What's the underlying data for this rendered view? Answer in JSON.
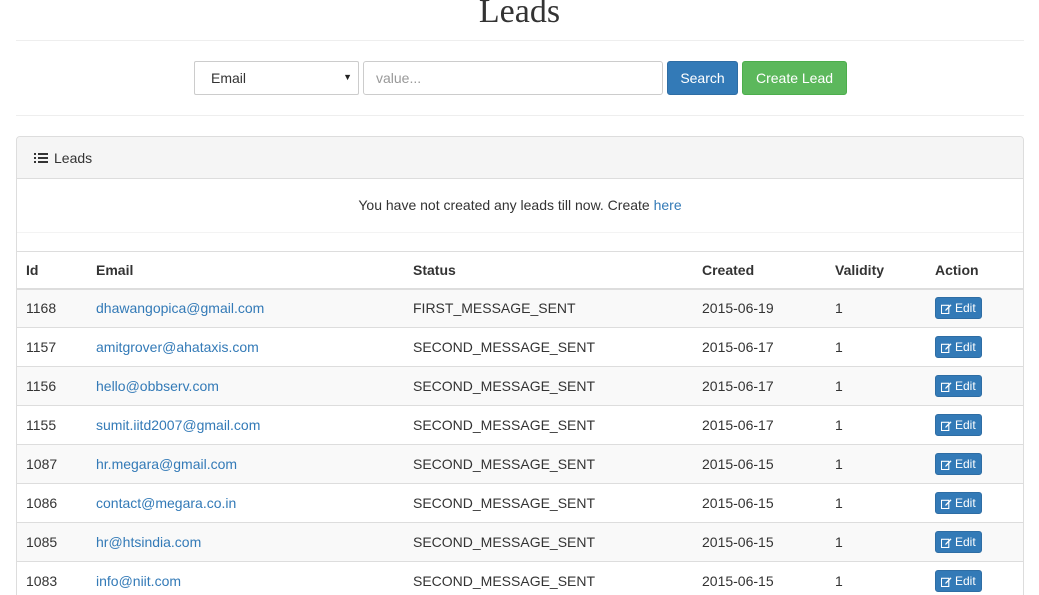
{
  "page": {
    "title": "Leads"
  },
  "search": {
    "field_selected": "Email",
    "placeholder": "value...",
    "search_label": "Search",
    "create_label": "Create Lead"
  },
  "panel": {
    "heading": "Leads",
    "heading_icon": "list-icon",
    "empty_message": "You have not created any leads till now. Create",
    "empty_link": "here"
  },
  "table": {
    "columns": [
      "Id",
      "Email",
      "Status",
      "Created",
      "Validity",
      "Action"
    ],
    "edit_label": "Edit",
    "rows": [
      {
        "id": "1168",
        "email": "dhawangopica@gmail.com",
        "status": "FIRST_MESSAGE_SENT",
        "created": "2015-06-19",
        "validity": "1"
      },
      {
        "id": "1157",
        "email": "amitgrover@ahataxis.com",
        "status": "SECOND_MESSAGE_SENT",
        "created": "2015-06-17",
        "validity": "1"
      },
      {
        "id": "1156",
        "email": "hello@obbserv.com",
        "status": "SECOND_MESSAGE_SENT",
        "created": "2015-06-17",
        "validity": "1"
      },
      {
        "id": "1155",
        "email": "sumit.iitd2007@gmail.com",
        "status": "SECOND_MESSAGE_SENT",
        "created": "2015-06-17",
        "validity": "1"
      },
      {
        "id": "1087",
        "email": "hr.megara@gmail.com",
        "status": "SECOND_MESSAGE_SENT",
        "created": "2015-06-15",
        "validity": "1"
      },
      {
        "id": "1086",
        "email": "contact@megara.co.in",
        "status": "SECOND_MESSAGE_SENT",
        "created": "2015-06-15",
        "validity": "1"
      },
      {
        "id": "1085",
        "email": "hr@htsindia.com",
        "status": "SECOND_MESSAGE_SENT",
        "created": "2015-06-15",
        "validity": "1"
      },
      {
        "id": "1083",
        "email": "info@niit.com",
        "status": "SECOND_MESSAGE_SENT",
        "created": "2015-06-15",
        "validity": "1"
      }
    ]
  },
  "colors": {
    "primary": "#337ab7",
    "success": "#5cb85c"
  }
}
